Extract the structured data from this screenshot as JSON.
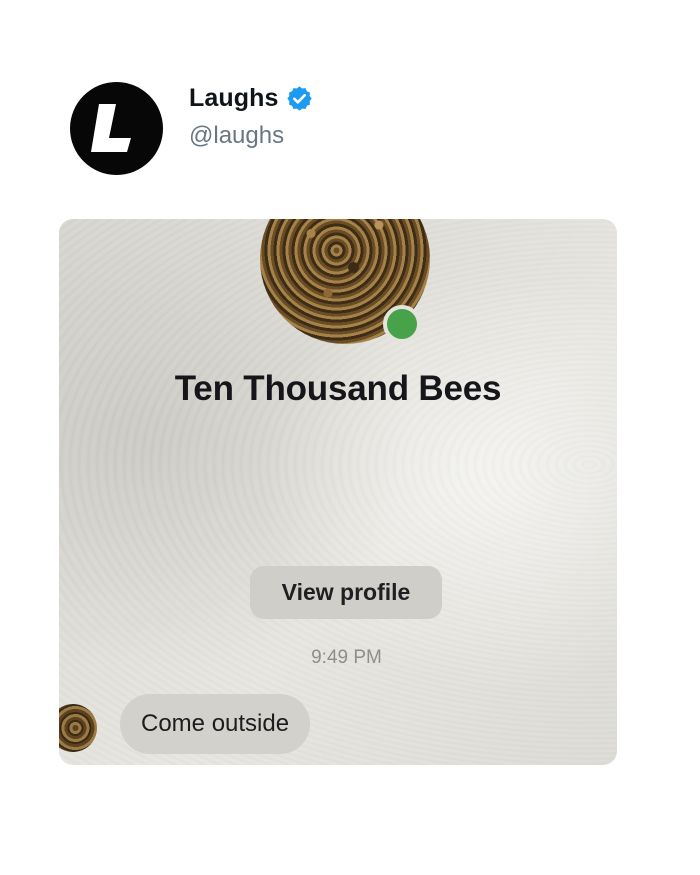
{
  "tweet": {
    "account": {
      "display_name": "Laughs",
      "handle": "@laughs",
      "avatar_letter": "L",
      "verified": true,
      "verified_color": "#1d9bf0"
    }
  },
  "screenshot": {
    "contact": {
      "name": "Ten Thousand Bees",
      "online": true,
      "online_color": "#48a24a"
    },
    "view_profile_label": "View profile",
    "timestamp": "9:49 PM",
    "messages": [
      {
        "text": "Come outside",
        "direction": "incoming"
      }
    ]
  }
}
